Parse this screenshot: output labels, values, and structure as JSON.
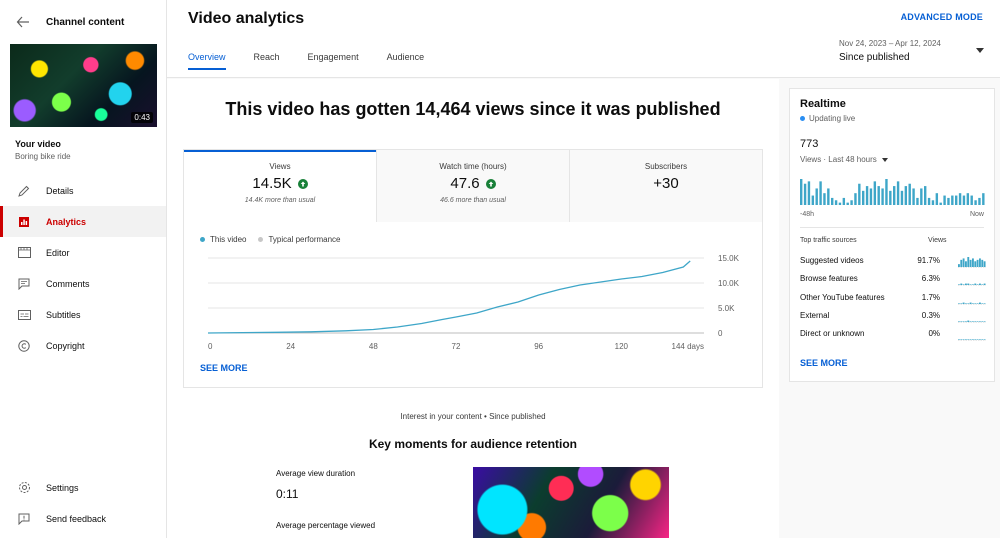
{
  "sidebar": {
    "title": "Channel content",
    "thumbnail_duration": "0:43",
    "your_video_label": "Your video",
    "video_name": "Boring bike ride",
    "items": [
      {
        "label": "Details",
        "icon": "pencil-icon"
      },
      {
        "label": "Analytics",
        "icon": "analytics-icon",
        "active": true
      },
      {
        "label": "Editor",
        "icon": "film-icon"
      },
      {
        "label": "Comments",
        "icon": "comment-icon"
      },
      {
        "label": "Subtitles",
        "icon": "subtitles-icon"
      },
      {
        "label": "Copyright",
        "icon": "copyright-icon"
      }
    ],
    "bottom_items": [
      {
        "label": "Settings",
        "icon": "gear-icon"
      },
      {
        "label": "Send feedback",
        "icon": "feedback-icon"
      }
    ]
  },
  "header": {
    "title": "Video analytics",
    "advanced_mode": "ADVANCED MODE",
    "tabs": [
      "Overview",
      "Reach",
      "Engagement",
      "Audience"
    ],
    "date_range": "Nov 24, 2023 – Apr 12, 2024",
    "period": "Since published"
  },
  "main": {
    "headline": "This video has gotten 14,464 views since it was published",
    "metrics": [
      {
        "label": "Views",
        "value": "14.5K",
        "sub": "14.4K more than usual",
        "trend_up": true
      },
      {
        "label": "Watch time (hours)",
        "value": "47.6",
        "sub": "46.6 more than usual",
        "trend_up": true
      },
      {
        "label": "Subscribers",
        "value": "+30",
        "sub": ""
      }
    ],
    "legend": {
      "this_video": "This video",
      "typical": "Typical performance"
    },
    "see_more": "SEE MORE",
    "interest": "Interest in your content • Since published",
    "key_moments_title": "Key moments for audience retention",
    "avg_view_duration_label": "Average view duration",
    "avg_view_duration": "0:11",
    "avg_percentage_label": "Average percentage viewed"
  },
  "chart_data": {
    "type": "line",
    "x_tick_labels": [
      "0",
      "24",
      "48",
      "72",
      "96",
      "120",
      "144 days"
    ],
    "y_tick_labels": [
      "15.0K",
      "10.0K",
      "5.0K",
      "0"
    ],
    "xlim": [
      0,
      144
    ],
    "ylim": [
      0,
      15000
    ],
    "grid": true,
    "series": [
      {
        "name": "This video",
        "color": "#3ea6c8",
        "x": [
          0,
          10,
          20,
          30,
          40,
          48,
          55,
          62,
          68,
          72,
          78,
          84,
          90,
          96,
          102,
          108,
          114,
          120,
          126,
          132,
          138,
          140
        ],
        "y": [
          0,
          80,
          150,
          250,
          450,
          700,
          1200,
          1900,
          2700,
          3200,
          4000,
          5200,
          6200,
          7600,
          8700,
          9600,
          10200,
          10800,
          11300,
          12100,
          13200,
          14400
        ]
      }
    ]
  },
  "realtime": {
    "title": "Realtime",
    "status": "Updating live",
    "count": "773",
    "sub": "Views · Last 48 hours",
    "axis_left": "-48h",
    "axis_right": "Now",
    "bars": [
      22,
      18,
      20,
      8,
      14,
      20,
      10,
      14,
      6,
      4,
      2,
      6,
      2,
      4,
      10,
      18,
      12,
      16,
      14,
      20,
      16,
      14,
      22,
      12,
      16,
      20,
      12,
      16,
      18,
      14,
      6,
      14,
      16,
      6,
      4,
      10,
      2,
      8,
      6,
      8,
      8,
      10,
      8,
      10,
      8,
      4,
      6,
      10
    ],
    "traffic_header": "Top traffic sources",
    "traffic_metric": "Views",
    "sources": [
      {
        "name": "Suggested videos",
        "pct": "91.7%",
        "spark": [
          2,
          5,
          6,
          4,
          7,
          5,
          6,
          4,
          5,
          6,
          5,
          4
        ]
      },
      {
        "name": "Browse features",
        "pct": "6.3%",
        "spark": [
          0,
          1,
          0,
          1,
          1,
          0,
          0,
          1,
          0,
          1,
          0,
          1
        ]
      },
      {
        "name": "Other YouTube features",
        "pct": "1.7%",
        "spark": [
          0,
          0,
          1,
          0,
          0,
          1,
          0,
          0,
          0,
          1,
          0,
          0
        ]
      },
      {
        "name": "External",
        "pct": "0.3%",
        "spark": [
          0,
          0,
          0,
          0,
          1,
          0,
          0,
          0,
          0,
          0,
          0,
          0
        ]
      },
      {
        "name": "Direct or unknown",
        "pct": "0%",
        "spark": [
          0,
          0,
          0,
          0,
          0,
          0,
          0,
          0,
          0,
          0,
          0,
          0
        ]
      }
    ],
    "see_more": "SEE MORE"
  },
  "colors": {
    "accent": "#065fd4",
    "active_nav": "#cc0000",
    "trend_up": "#188038",
    "series": "#3ea6c8",
    "realtime_bars": "#3ea6c8"
  }
}
